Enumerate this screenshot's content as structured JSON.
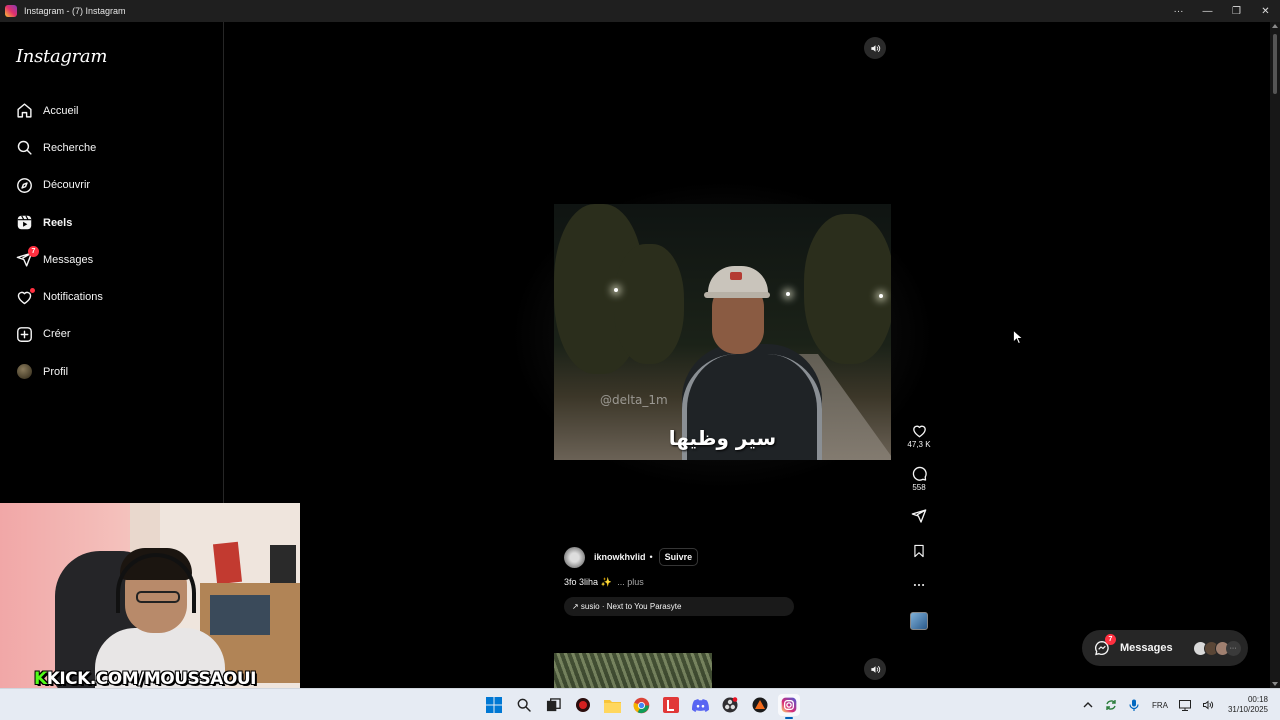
{
  "window": {
    "title": "Instagram - (7) Instagram",
    "controls": {
      "more": "···",
      "minimize": "—",
      "restore": "❐",
      "close": "✕"
    }
  },
  "sidebar": {
    "logo": "Instagram",
    "items": [
      {
        "label": "Accueil",
        "icon": "home-icon"
      },
      {
        "label": "Recherche",
        "icon": "search-icon"
      },
      {
        "label": "Découvrir",
        "icon": "compass-icon"
      },
      {
        "label": "Reels",
        "icon": "reels-icon",
        "active": true
      },
      {
        "label": "Messages",
        "icon": "messenger-icon",
        "badge": "7"
      },
      {
        "label": "Notifications",
        "icon": "heart-icon",
        "dot": true
      },
      {
        "label": "Créer",
        "icon": "plus-square-icon"
      },
      {
        "label": "Profil",
        "icon": "avatar"
      }
    ]
  },
  "webcam": {
    "overlay_prefix": "K",
    "overlay_text": "KICK.COM/MOUSSAOUI"
  },
  "reel": {
    "watermark": "@delta_1m",
    "subtitle": "سير وظيها",
    "likes": "47,3 K",
    "comments": "558",
    "author": "iknowkhvlid",
    "separator": "•",
    "follow_label": "Suivre",
    "caption": "3fo 3liha ✨",
    "caption_more": "... plus",
    "audio": "↗ susio · Next to You Parasyte"
  },
  "messages_pill": {
    "label": "Messages",
    "badge": "7",
    "more": "···"
  },
  "taskbar": {
    "lang": "FRA",
    "time": "00:18",
    "date": "31/10/2025"
  }
}
